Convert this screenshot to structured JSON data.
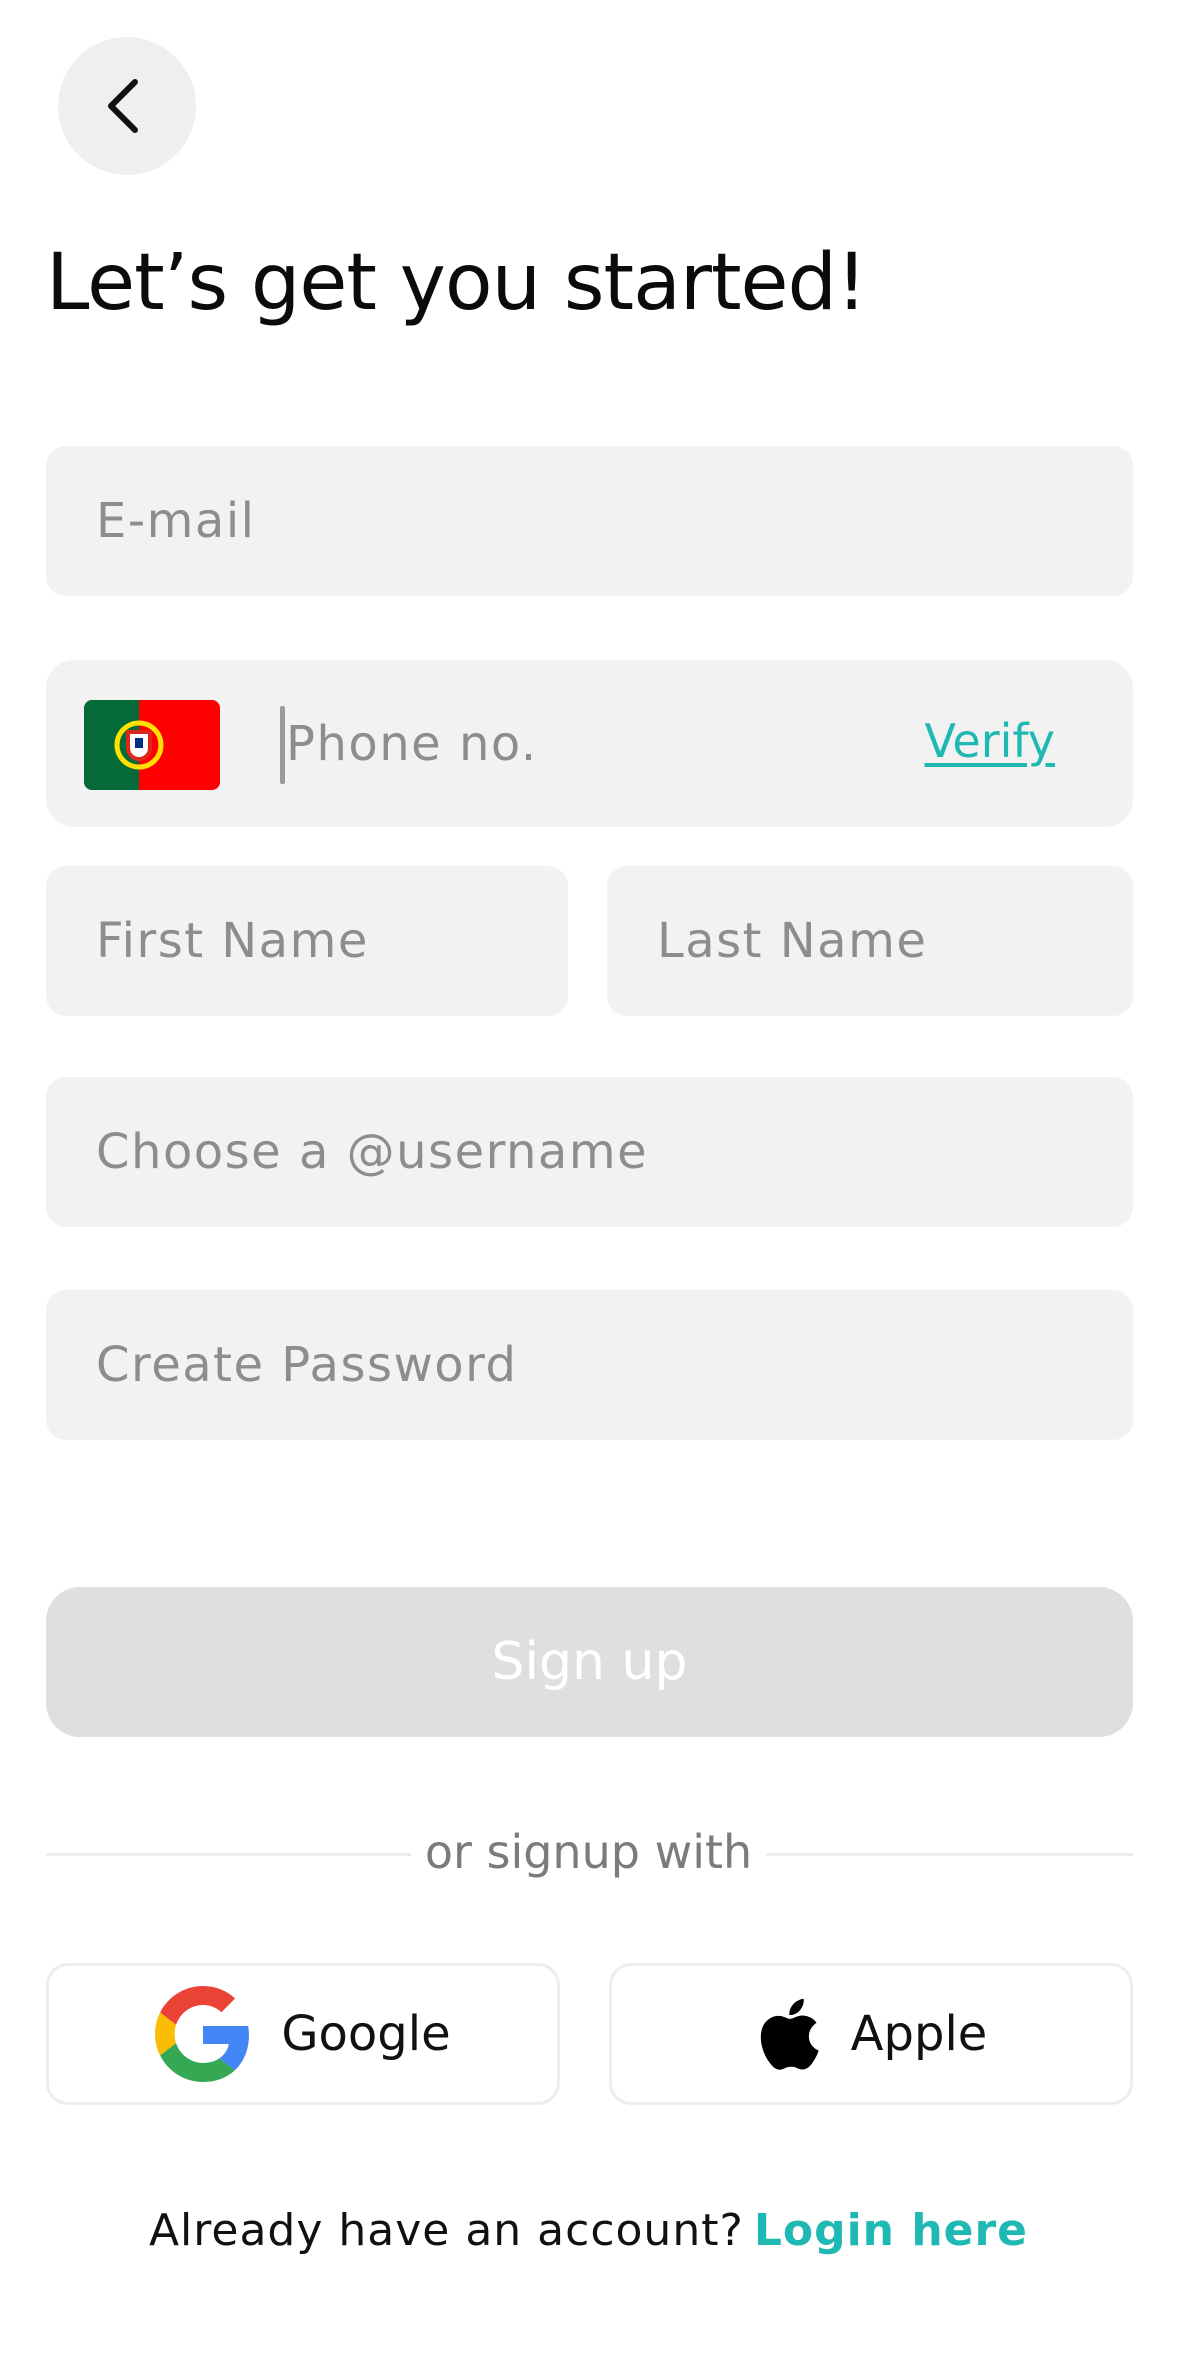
{
  "header": {
    "back_icon": "chevron-left-icon",
    "title": "Let’s get you started!"
  },
  "form": {
    "email": {
      "value": "",
      "placeholder": "E-mail"
    },
    "phone": {
      "country_flag": "portugal-flag-icon",
      "value": "",
      "placeholder": "Phone no.",
      "verify_label": "Verify"
    },
    "first_name": {
      "value": "",
      "placeholder": "First Name"
    },
    "last_name": {
      "value": "",
      "placeholder": "Last Name"
    },
    "username": {
      "value": "",
      "placeholder": "Choose a @username"
    },
    "password": {
      "value": "",
      "placeholder": "Create Password"
    },
    "signup_label": "Sign up"
  },
  "social": {
    "divider_text": "or signup with",
    "google": {
      "icon": "google-icon",
      "label": "Google"
    },
    "apple": {
      "icon": "apple-icon",
      "label": "Apple"
    }
  },
  "footer": {
    "prompt": "Already have an account?",
    "login_label": "Login here"
  },
  "colors": {
    "accent": "#1fb8b2",
    "field_background": "#f2f2f2",
    "button_disabled": "#dfdfdf",
    "placeholder": "#8d8d8d"
  }
}
